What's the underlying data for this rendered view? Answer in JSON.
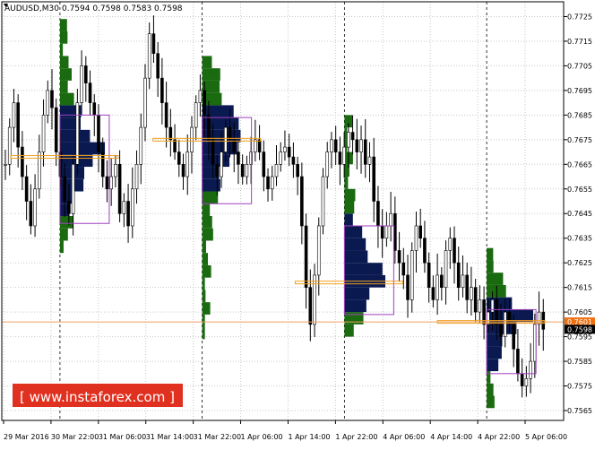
{
  "header": {
    "symbol": "AUDUSD,M30",
    "ohlc": "0.7594 0.7598 0.7583 0.7598"
  },
  "watermark": "www.instaforex.com",
  "colors": {
    "background": "#ffffff",
    "candle": "#000000",
    "grid": "#c8c8c8",
    "profile_dark": "#0a1a50",
    "profile_green": "#1a6a10",
    "poc_line": "#f0a020",
    "value_area_box": "#a040c0",
    "price_line": "#f0a060",
    "current_price_badge": "#f07010",
    "watermark_bg": "#e03020"
  },
  "chart_data": {
    "type": "candlestick",
    "y_ticks": [
      "0.7725",
      "0.7715",
      "0.7705",
      "0.7695",
      "0.7685",
      "0.7675",
      "0.7665",
      "0.7655",
      "0.7645",
      "0.7635",
      "0.7625",
      "0.7615",
      "0.7605",
      "0.7595",
      "0.7585",
      "0.7575",
      "0.7565"
    ],
    "x_ticks": [
      "29 Mar 2016",
      "30 Mar 22:00",
      "31 Mar 06:00",
      "31 Mar 14:00",
      "31 Mar 22:00",
      "1 Apr 06:00",
      "1 Apr 14:00",
      "1 Apr 22:00",
      "4 Apr 06:00",
      "4 Apr 14:00",
      "4 Apr 22:00",
      "5 Apr 06:00"
    ],
    "ylim": [
      0.7561,
      0.7731
    ],
    "badges": {
      "upper": "0.7601",
      "current": "0.7598"
    },
    "session_separators": [
      "30 Mar 22:00",
      "31 Mar 22:00",
      "1 Apr 22:00",
      "4 Apr 22:00"
    ],
    "closes": [
      0.7665,
      0.768,
      0.769,
      0.7672,
      0.766,
      0.765,
      0.764,
      0.7655,
      0.767,
      0.7685,
      0.7695,
      0.7688,
      0.767,
      0.766,
      0.765,
      0.7645,
      0.7665,
      0.769,
      0.7705,
      0.7698,
      0.769,
      0.7685,
      0.767,
      0.766,
      0.7655,
      0.766,
      0.7665,
      0.7645,
      0.765,
      0.764,
      0.7655,
      0.7665,
      0.768,
      0.77,
      0.7718,
      0.771,
      0.77,
      0.769,
      0.768,
      0.7675,
      0.767,
      0.7665,
      0.766,
      0.767,
      0.768,
      0.769,
      0.7695,
      0.7685,
      0.7675,
      0.7665,
      0.766,
      0.767,
      0.768,
      0.7675,
      0.767,
      0.7665,
      0.766,
      0.7665,
      0.767,
      0.7675,
      0.767,
      0.766,
      0.7655,
      0.766,
      0.7665,
      0.767,
      0.7672,
      0.7668,
      0.7665,
      0.766,
      0.764,
      0.7615,
      0.76,
      0.762,
      0.764,
      0.766,
      0.767,
      0.7675,
      0.767,
      0.7665,
      0.7672,
      0.7678,
      0.7675,
      0.767,
      0.7675,
      0.7665,
      0.7668,
      0.765,
      0.764,
      0.7635,
      0.764,
      0.7645,
      0.763,
      0.7625,
      0.762,
      0.761,
      0.763,
      0.764,
      0.7635,
      0.7625,
      0.7615,
      0.761,
      0.762,
      0.7615,
      0.763,
      0.7635,
      0.7625,
      0.7615,
      0.762,
      0.761,
      0.7615,
      0.7605,
      0.761,
      0.76,
      0.7605,
      0.761,
      0.76,
      0.7595,
      0.7605,
      0.76,
      0.759,
      0.758,
      0.7575,
      0.7578,
      0.7585,
      0.76,
      0.7605,
      0.7598
    ]
  }
}
